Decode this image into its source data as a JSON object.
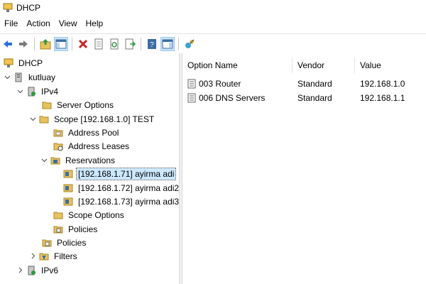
{
  "window": {
    "title": "DHCP"
  },
  "menu": [
    "File",
    "Action",
    "View",
    "Help"
  ],
  "toolbar": {
    "buttons": [
      "back-arrow-icon",
      "forward-arrow-icon",
      "up-folder-icon",
      "show-hide-tree-icon",
      "delete-icon",
      "properties-icon",
      "refresh-icon",
      "export-list-icon",
      "help-icon",
      "show-hide-action-pane-icon",
      "dhcp-options-icon"
    ]
  },
  "tree": {
    "root": "DHCP",
    "server": "kutluay",
    "ipv4": "IPv4",
    "server_options": "Server Options",
    "scope": "Scope [192.168.1.0] TEST",
    "address_pool": "Address Pool",
    "address_leases": "Address Leases",
    "reservations": "Reservations",
    "res1": "[192.168.1.71] ayirma adi",
    "res2": "[192.168.1.72] ayirma adi2",
    "res3": "[192.168.1.73] ayirma adi3",
    "scope_options": "Scope Options",
    "scope_policies": "Policies",
    "policies": "Policies",
    "filters": "Filters",
    "ipv6": "IPv6"
  },
  "list": {
    "headers": {
      "name": "Option Name",
      "vendor": "Vendor",
      "value": "Value"
    },
    "rows": [
      {
        "name": "003 Router",
        "vendor": "Standard",
        "value": "192.168.1.0"
      },
      {
        "name": "006 DNS Servers",
        "vendor": "Standard",
        "value": "192.168.1.1"
      }
    ]
  },
  "colors": {
    "selection": "#cce8ff",
    "folder": "#e8c25a",
    "accent": "#1e6fd9"
  }
}
